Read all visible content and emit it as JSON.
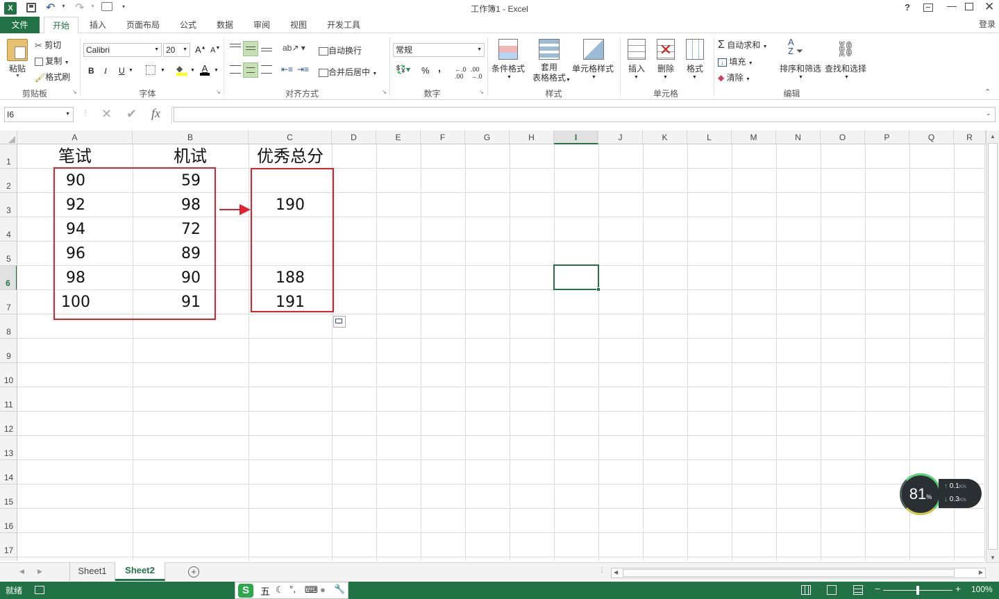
{
  "window": {
    "title": "工作簿1 - Excel",
    "help": "?",
    "sign_in": "登录"
  },
  "tabs": [
    "文件",
    "开始",
    "插入",
    "页面布局",
    "公式",
    "数据",
    "审阅",
    "视图",
    "开发工具"
  ],
  "ribbon": {
    "clipboard": {
      "paste": "粘贴",
      "cut": "剪切",
      "copy": "复制",
      "format_painter": "格式刷",
      "label": "剪贴板"
    },
    "font": {
      "name": "Calibri",
      "size": "20",
      "bold": "B",
      "italic": "I",
      "underline": "U",
      "font_color_glyph": "A",
      "label": "字体"
    },
    "alignment": {
      "wrap": "自动换行",
      "merge": "合并后居中",
      "label": "对齐方式"
    },
    "number": {
      "format": "常规",
      "percent": "%",
      "comma": ",",
      "label": "数字"
    },
    "styles": {
      "conditional": "条件格式",
      "table_1": "套用",
      "table_2": "表格格式",
      "cell_styles": "单元格样式",
      "label": "样式"
    },
    "cells": {
      "insert": "插入",
      "delete": "删除",
      "format": "格式",
      "label": "单元格"
    },
    "editing": {
      "autosum": "自动求和",
      "fill": "填充",
      "clear": "清除",
      "sort": "排序和筛选",
      "find": "查找和选择",
      "label": "编辑"
    }
  },
  "formula_bar": {
    "name_box": "I6",
    "fx": "fx",
    "value": ""
  },
  "columns": [
    "A",
    "B",
    "C",
    "D",
    "E",
    "F",
    "G",
    "H",
    "I",
    "J",
    "K",
    "L",
    "M",
    "N",
    "O",
    "P",
    "Q",
    "R"
  ],
  "rows": [
    "1",
    "2",
    "3",
    "4",
    "5",
    "6",
    "7",
    "8",
    "9",
    "10",
    "11",
    "12",
    "13",
    "14",
    "15",
    "16",
    "17"
  ],
  "cells": {
    "A1": "笔试",
    "B1": "机试",
    "C1": "优秀总分",
    "A2": "90",
    "B2": "59",
    "A3": "92",
    "B3": "98",
    "C3": "190",
    "A4": "94",
    "B4": "72",
    "A5": "96",
    "B5": "89",
    "A6": "98",
    "B6": "90",
    "C6": "188",
    "A7": "100",
    "B7": "91",
    "C7": "191"
  },
  "selected_cell": "I6",
  "sheets": [
    "Sheet1",
    "Sheet2"
  ],
  "active_sheet": "Sheet2",
  "status": {
    "ready": "就绪",
    "zoom": "100%"
  },
  "ime": {
    "mode": "五"
  },
  "net_widget": {
    "percent": "81",
    "percent_sign": "%",
    "up": "0.1",
    "down": "0.3",
    "unit": "K/s"
  },
  "colors": {
    "excel_green": "#217346",
    "annotation_red": "#e0202a",
    "selection": "#217346"
  }
}
